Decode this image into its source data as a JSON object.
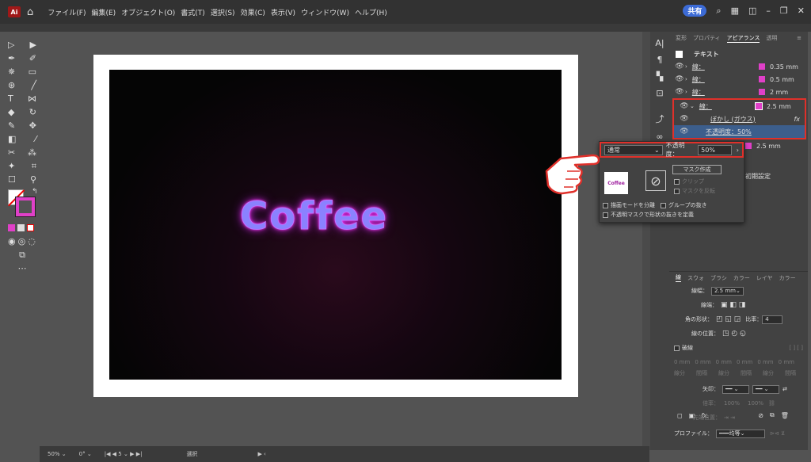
{
  "menubar": {
    "logo": "Ai",
    "items": [
      "ファイル(F)",
      "編集(E)",
      "オブジェクト(O)",
      "書式(T)",
      "選択(S)",
      "効果(C)",
      "表示(V)",
      "ウィンドウ(W)",
      "ヘルプ(H)"
    ],
    "share_label": "共有"
  },
  "artboard": {
    "artwork_text": "Coffee"
  },
  "panel": {
    "tabs": [
      "変形",
      "プロパティ",
      "アピアランス",
      "透明"
    ],
    "active_tab": "アピアランス",
    "object_label": "テキスト",
    "rows": [
      {
        "label": "線：",
        "value": "0.35 mm"
      },
      {
        "label": "線：",
        "value": "0.5 mm"
      },
      {
        "label": "線：",
        "value": "2 mm"
      },
      {
        "label": "線：",
        "value": "2.5 mm"
      }
    ],
    "effect_blur": "ぼかし (ガウス)",
    "opacity_row": "不透明度：50%",
    "hidden_row_value": "2.5 mm",
    "fx_label": "fx"
  },
  "transparency_popup": {
    "blend_mode": "通常",
    "opacity_label": "不透明度：",
    "opacity_value": "50%",
    "thumbnail_text": "Coffee",
    "mask_button": "マスク作成",
    "clip_label": "クリップ",
    "invert_label": "マスクを反転",
    "isolate_label": "描画モードを分離",
    "knockout_label": "グループの抜き",
    "mask_knockout_label": "不透明マスクで形状の抜きを定義",
    "initial_label": "初期設定"
  },
  "stroke_panel": {
    "tabs": [
      "線",
      "スウォ",
      "ブラシ",
      "カラー",
      "レイヤ",
      "カラー"
    ],
    "weight_label": "線幅：",
    "weight_value": "2.5 mm",
    "cap_label": "線端：",
    "corner_label": "角の形状：",
    "ratio_label": "比率：",
    "ratio_value": "4",
    "align_label": "線の位置：",
    "dash_label": "破線",
    "dash_cells": [
      "0 mm",
      "0 mm",
      "0 mm",
      "0 mm",
      "0 mm",
      "0 mm"
    ],
    "dash_sub": [
      "線分",
      "間隔",
      "線分",
      "間隔",
      "線分",
      "間隔"
    ],
    "arrow_label": "矢印：",
    "scale_label": "倍率：",
    "scale_value1": "100%",
    "scale_value2": "100%",
    "tip_label": "先端位置：",
    "profile_label": "プロファイル：",
    "profile_value": "均等"
  },
  "statusbar": {
    "zoom": "50%",
    "rotation": "0°",
    "artboard_num": "5",
    "tool": "選択"
  }
}
